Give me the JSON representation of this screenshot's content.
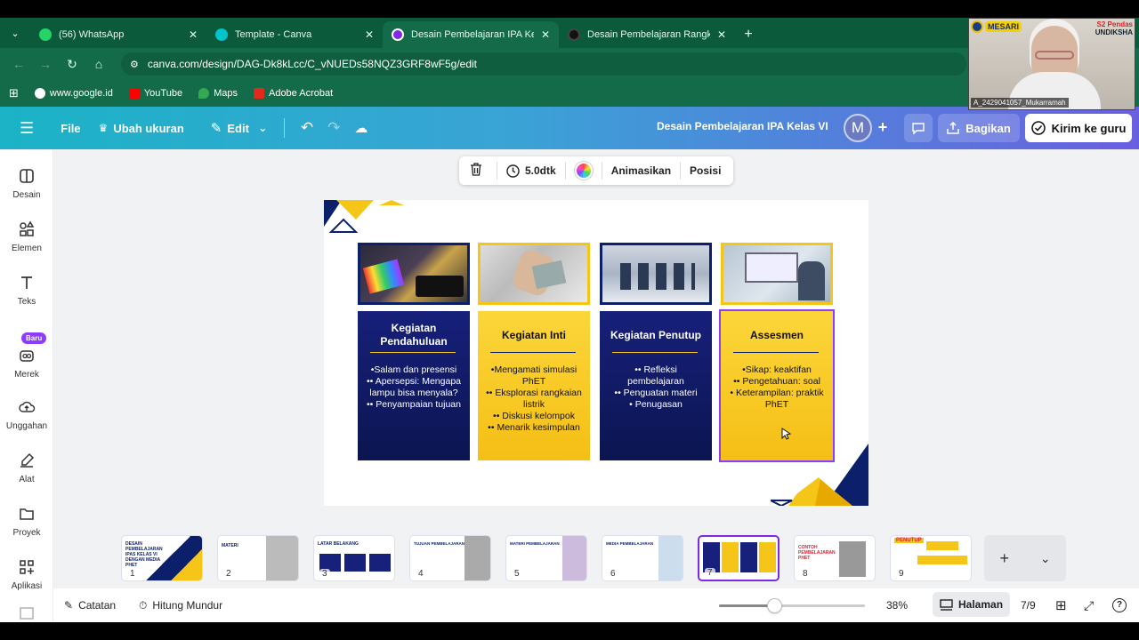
{
  "tabs": [
    {
      "title": "(56) WhatsApp",
      "icon_color": "#25d366",
      "active": false
    },
    {
      "title": "Template - Canva",
      "icon_color": "#00c4cc",
      "active": false
    },
    {
      "title": "Desain Pembelajaran IPA Kelas VI",
      "icon_color": "#7d2ae8",
      "active": true
    },
    {
      "title": "Desain Pembelajaran Rangkaian",
      "icon_color": "#111111",
      "active": false
    }
  ],
  "url": "canva.com/design/DAG-Dk8kLcc/C_vNUEDs58NQZ3GRF8wF5g/edit",
  "bookmarks": [
    {
      "label": "www.google.id",
      "color": "#ffffff"
    },
    {
      "label": "YouTube",
      "color": "#ff0000"
    },
    {
      "label": "Maps",
      "color": "#34a853"
    },
    {
      "label": "Adobe Acrobat",
      "color": "#e22a1a"
    }
  ],
  "header": {
    "file": "File",
    "resize": "Ubah ukuran",
    "edit": "Edit",
    "design_title": "Desain Pembelajaran IPA Kelas VI",
    "avatar": "M",
    "share": "Bagikan",
    "send": "Kirim ke guru"
  },
  "left_panel": [
    {
      "label": "Desain"
    },
    {
      "label": "Elemen"
    },
    {
      "label": "Teks"
    },
    {
      "label": "Merek",
      "badge": "Baru"
    },
    {
      "label": "Unggahan"
    },
    {
      "label": "Alat"
    },
    {
      "label": "Proyek"
    },
    {
      "label": "Aplikasi"
    }
  ],
  "toolbar": {
    "duration": "5.0dtk",
    "animate": "Animasikan",
    "position": "Posisi"
  },
  "slide": {
    "cards": [
      {
        "title": "Kegiatan Pendahuluan",
        "body": "•Salam dan presensi\n•• Apersepsi: Mengapa lampu bisa menyala?\n•• Penyampaian tujuan",
        "theme": "dark"
      },
      {
        "title": "Kegiatan Inti",
        "body": "•Mengamati simulasi PhET\n•• Eksplorasi rangkaian listrik\n•• Diskusi kelompok\n•• Menarik kesimpulan",
        "theme": "light"
      },
      {
        "title": "Kegiatan Penutup",
        "body": "•• Refleksi pembelajaran\n•• Penguatan materi\n• Penugasan",
        "theme": "dark"
      },
      {
        "title": "Assesmen",
        "body": "•Sikap: keaktifan\n•• Pengetahuan: soal\n• Keterampilan: praktik PhET",
        "theme": "light"
      }
    ]
  },
  "thumbs": [
    {
      "num": "1",
      "text": "DESAIN PEMBELAJARAN IPAS KELAS VI DENGAN MEDIA PHET"
    },
    {
      "num": "2",
      "text": "MATERI"
    },
    {
      "num": "3",
      "text": "LATAR BELAKANG"
    },
    {
      "num": "4",
      "text": "TUJUAN PEMBELAJARAN"
    },
    {
      "num": "5",
      "text": "MATERI PEMBELAJARAN"
    },
    {
      "num": "6",
      "text": "MEDIA PEMBELAJARAN"
    },
    {
      "num": "7",
      "text": ""
    },
    {
      "num": "8",
      "text": "CONTOH PEMBELAJARAN PHET"
    },
    {
      "num": "9",
      "text": "PENUTUP"
    }
  ],
  "footer": {
    "notes": "Catatan",
    "timer": "Hitung Mundur",
    "zoom": "38%",
    "pages": "Halaman",
    "page_count": "7/9"
  },
  "zoom_fraction": 0.38,
  "webcam": {
    "brand_top": "S2 Pendas",
    "brand_bottom": "UNDIKSHA",
    "logo_text": "MESARI",
    "name": "A_2429041057_Mukarramah"
  }
}
